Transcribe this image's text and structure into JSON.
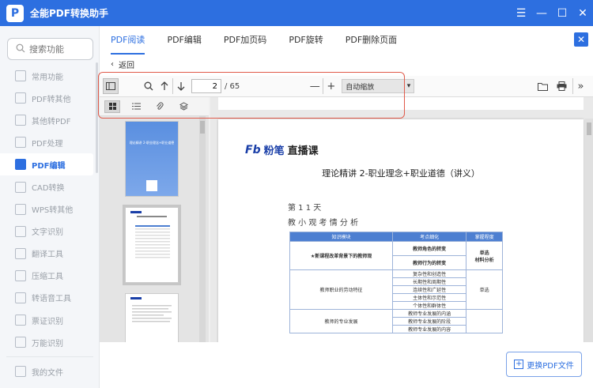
{
  "app": {
    "title": "全能PDF转换助手",
    "logo_glyph": "P"
  },
  "window": {
    "menu_glyph": "☰",
    "minimize_glyph": "—",
    "maximize_glyph": "☐",
    "close_glyph": "✕"
  },
  "sidebar": {
    "search_placeholder": "搜索功能",
    "items": [
      {
        "label": "常用功能"
      },
      {
        "label": "PDF转其他"
      },
      {
        "label": "其他转PDF"
      },
      {
        "label": "PDF处理"
      },
      {
        "label": "PDF编辑",
        "active": true
      },
      {
        "label": "CAD转换"
      },
      {
        "label": "WPS转其他"
      },
      {
        "label": "文字识别"
      },
      {
        "label": "翻译工具"
      },
      {
        "label": "压缩工具"
      },
      {
        "label": "转语音工具"
      },
      {
        "label": "票证识别"
      },
      {
        "label": "万能识别"
      }
    ],
    "my_files": "我的文件"
  },
  "tabs": [
    {
      "label": "PDF阅读",
      "active": true
    },
    {
      "label": "PDF编辑"
    },
    {
      "label": "PDF加页码"
    },
    {
      "label": "PDF旋转"
    },
    {
      "label": "PDF删除页面"
    }
  ],
  "close_glyph": "✕",
  "back": {
    "label": "返回",
    "glyph": "‹"
  },
  "toolbar": {
    "current_page": "2",
    "page_count": "/ 65",
    "zoom_minus": "—",
    "zoom_plus": "+",
    "zoom_mode": "自动缩放",
    "chevron": "▾",
    "more": "»"
  },
  "document": {
    "brand_fb": "Fb",
    "brand_name": "粉笔",
    "brand_live": "直播课",
    "title": "理论精讲 2-职业理念+职业道德（讲义）",
    "handwriting_1": "第 1 1 天",
    "handwriting_2": "教 小 观    考 情 分 析",
    "table_headers": [
      "知识模块",
      "考点细化",
      "掌握程度"
    ],
    "table_rows": [
      [
        "★新课程改革背景下的教师观",
        "教师角色的转变",
        "单选\n材料分析"
      ],
      [
        "",
        "教师行为的转变",
        ""
      ],
      [
        "教师职业的劳动特征",
        "复杂性和创造性",
        "单选"
      ],
      [
        "",
        "长期性和周期性",
        ""
      ],
      [
        "",
        "连续性和广延性",
        ""
      ],
      [
        "",
        "主体性和示范性",
        ""
      ],
      [
        "",
        "个体性和群体性",
        ""
      ],
      [
        "教师的专业发展",
        "教师专业发展的内涵",
        ""
      ],
      [
        "",
        "教师专业发展的阶段",
        ""
      ],
      [
        "",
        "教师专业发展的内容",
        ""
      ]
    ],
    "thumb_cover_title": "理论精讲 2-职业理念+职业道德"
  },
  "bottom": {
    "replace_label": "更换PDF文件",
    "plus": "+"
  }
}
